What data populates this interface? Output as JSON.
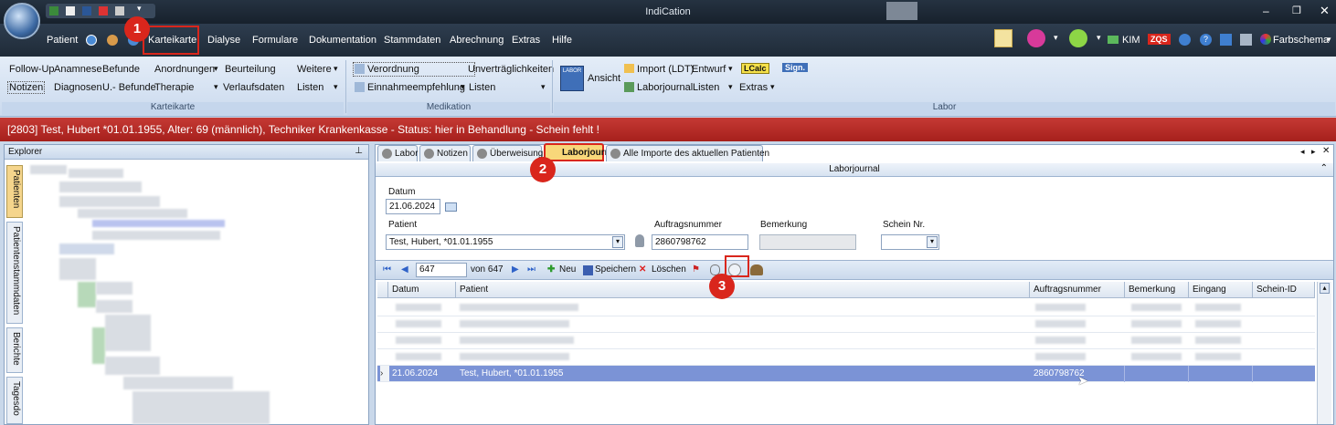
{
  "app": {
    "title": "IndiCation"
  },
  "ribbon_tabs": [
    "Patient",
    "Karteikarte",
    "Dialyse",
    "Formulare",
    "Dokumentation",
    "Stammdaten",
    "Abrechnung",
    "Extras",
    "Hilfe"
  ],
  "header_right": {
    "kim": "KIM",
    "zqs": "ZQS",
    "farbschema": "Farbschema"
  },
  "karteikarte_group": {
    "label": "Karteikarte",
    "row1": [
      "Follow-Up",
      "Anamnese",
      "Befunde",
      "Anordnungen",
      "Beurteilung",
      "Weitere"
    ],
    "row2": [
      "Notizen",
      "Diagnosen",
      "U.- Befunde",
      "Therapie",
      "Verlaufsdaten",
      "Listen"
    ]
  },
  "medikation_group": {
    "label": "Medikation",
    "row1": [
      "Verordnung",
      "Unverträglichkeiten"
    ],
    "row2": [
      "Einnahmeempfehlung",
      "Listen"
    ]
  },
  "labor_group": {
    "label": "Labor",
    "ansicht": "Ansicht",
    "icon_text": "LABOR",
    "row1": [
      "Import (LDT)",
      "Entwurf",
      "LCalc",
      "Sign."
    ],
    "row2": [
      "Laborjournal",
      "Listen",
      "Extras"
    ]
  },
  "alert": {
    "text": "[2803] Test, Hubert *01.01.1955,  Alter: 69 (männlich),  Techniker Krankenkasse  - Status: hier in Behandlung -    Schein fehlt !"
  },
  "explorer": {
    "title": "Explorer",
    "side_tabs": [
      "Patienten",
      "Patientenstammdaten",
      "Berichte",
      "Tagesdo"
    ]
  },
  "doc_tabs": [
    "Labor",
    "Notizen",
    "Überweisung",
    "Laborjournal",
    "Alle Importe des aktuellen Patienten"
  ],
  "section_title": "Laborjournal",
  "form": {
    "datum_label": "Datum",
    "datum_value": "21.06.2024",
    "patient_label": "Patient",
    "patient_value": "Test, Hubert, *01.01.1955",
    "auftrag_label": "Auftragsnummer",
    "auftrag_value": "2860798762",
    "bemerkung_label": "Bemerkung",
    "schein_label": "Schein Nr."
  },
  "navigator": {
    "position": "647",
    "of_text": "von 647",
    "neu": "Neu",
    "speichern": "Speichern",
    "loeschen": "Löschen"
  },
  "grid": {
    "columns": [
      "Datum",
      "Patient",
      "Auftragsnummer",
      "Bemerkung",
      "Eingang",
      "Schein-ID"
    ],
    "selected_row": {
      "datum": "21.06.2024",
      "patient": "Test, Hubert, *01.01.1955",
      "auftragsnummer": "2860798762"
    }
  },
  "annotations": [
    "1",
    "2",
    "3"
  ],
  "colors": {
    "alert": "#b52a25",
    "selection": "#7b93d6",
    "badge": "#d9261c"
  }
}
